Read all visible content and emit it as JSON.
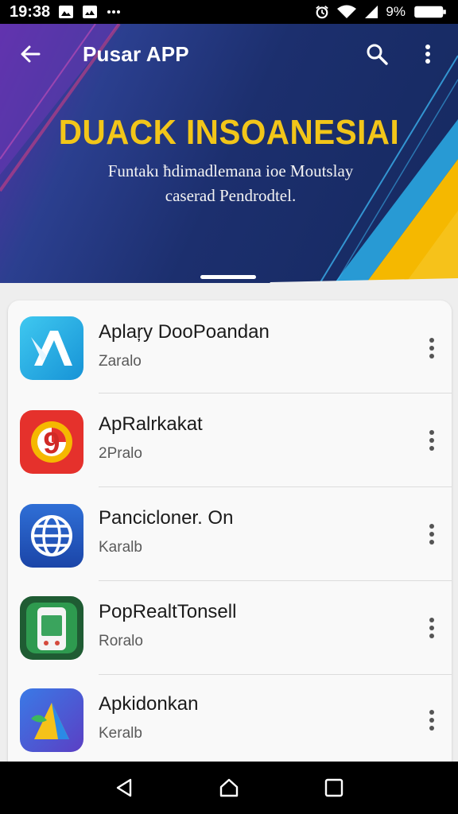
{
  "status_bar": {
    "time": "19:38",
    "battery_text": "9%",
    "icons": [
      "gallery-icon",
      "image-icon",
      "more-dots-icon",
      "alarm-icon",
      "wifi-icon",
      "signal-icon",
      "battery-icon"
    ]
  },
  "app_bar": {
    "title": "Pusar APP",
    "back_icon": "arrow-back-icon",
    "search_icon": "search-icon",
    "menu_icon": "more-vert-icon"
  },
  "hero": {
    "heading": "DUACK INSOANESIAI",
    "subtitle_line1": "Funtakı ħdimadlemana ioe Moutslay",
    "subtitle_line2": "caserad Pendrodtel.",
    "colors": {
      "heading": "#f2c619",
      "accent_yellow": "#f5b800",
      "accent_blue": "#2aa6e0"
    }
  },
  "apps": [
    {
      "title": "Aplaŗy DooPoandan",
      "subtitle": "Zaralo",
      "icon": "app-a-icon"
    },
    {
      "title": "ApRalrkakat",
      "subtitle": "2Pralo",
      "icon": "app-9-icon"
    },
    {
      "title": "Pancicloner. On",
      "subtitle": "Karalb",
      "icon": "globe-icon"
    },
    {
      "title": "PopRealtTonsell",
      "subtitle": "Roralo",
      "icon": "phone-icon"
    },
    {
      "title": "Apkidonkan",
      "subtitle": "Keralb",
      "icon": "arrow-play-icon"
    }
  ],
  "nav_bar": {
    "back": "nav-back-icon",
    "home": "nav-home-icon",
    "recents": "nav-recents-icon"
  }
}
